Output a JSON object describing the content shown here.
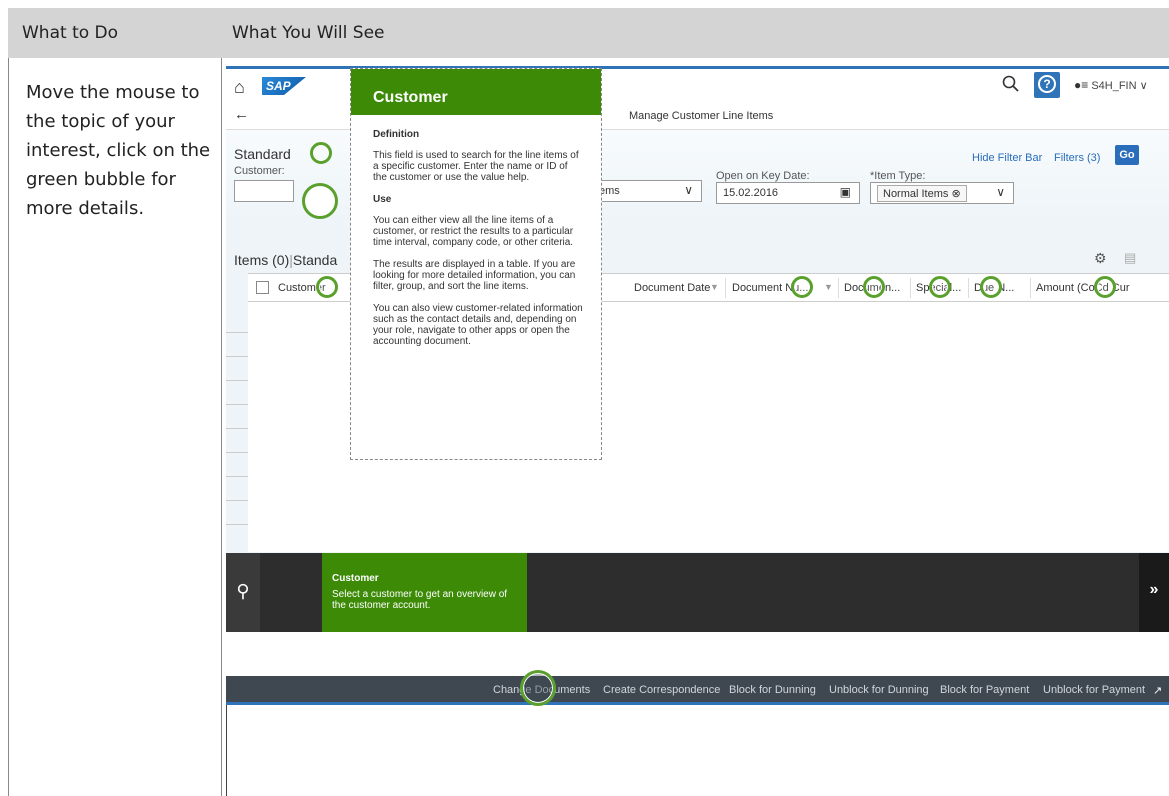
{
  "doc": {
    "col1_header": "What to Do",
    "col2_header": "What You Will See",
    "instruction": "Move the mouse to the topic of your interest, click on the green bubble for more details."
  },
  "shell": {
    "logo": "SAP",
    "user": "S4H_FIN",
    "app_title": "Manage Customer Line Items"
  },
  "filterbar": {
    "variant": "Standard",
    "hide_filter_bar": "Hide Filter Bar",
    "filters": "Filters (3)",
    "go": "Go",
    "customer_label": "Customer:",
    "status_partial": "ems",
    "key_date_label": "Open on Key Date:",
    "key_date_value": "15.02.2016",
    "item_type_label": "*Item Type:",
    "item_type_token": "Normal Items"
  },
  "table": {
    "title_prefix": "Items (0)",
    "title_variant": "Standa",
    "columns": [
      "Customer",
      "Document Date",
      "Document Nu...",
      "Documen...",
      "Special...",
      "Due N...",
      "Amount (CoCd Cur"
    ]
  },
  "tooltip": {
    "title": "Customer",
    "def_heading": "Definition",
    "def_text": "This field is used to search for the line items of a specific customer. Enter the name or ID of the customer or use the value help.",
    "use_heading": "Use",
    "use_p1": "You can either view all the line items of a customer, or restrict the results to a particular time interval, company code, or other criteria.",
    "use_p2": "The results are displayed in a table. If you are looking for more detailed information, you can filter, group, and sort the line items.",
    "use_p3": "You can also view customer-related information such as the contact details and, depending on your role, navigate to other apps or open the accounting document."
  },
  "guide": {
    "card_title": "Customer",
    "card_text": "Select a customer to get an overview of the customer account."
  },
  "footer": {
    "buttons": [
      "Change Documents",
      "Create Correspondence",
      "Block for Dunning",
      "Unblock for Dunning",
      "Block for Payment",
      "Unblock for Payment"
    ]
  },
  "colors": {
    "accent_green": "#3c8a06",
    "sap_blue": "#2a6dbb"
  },
  "icons": [
    "home-icon",
    "search-icon",
    "help-icon",
    "user-icon",
    "back-arrow-icon",
    "calendar-icon",
    "gear-icon",
    "export-icon",
    "chevron-right-icon"
  ]
}
